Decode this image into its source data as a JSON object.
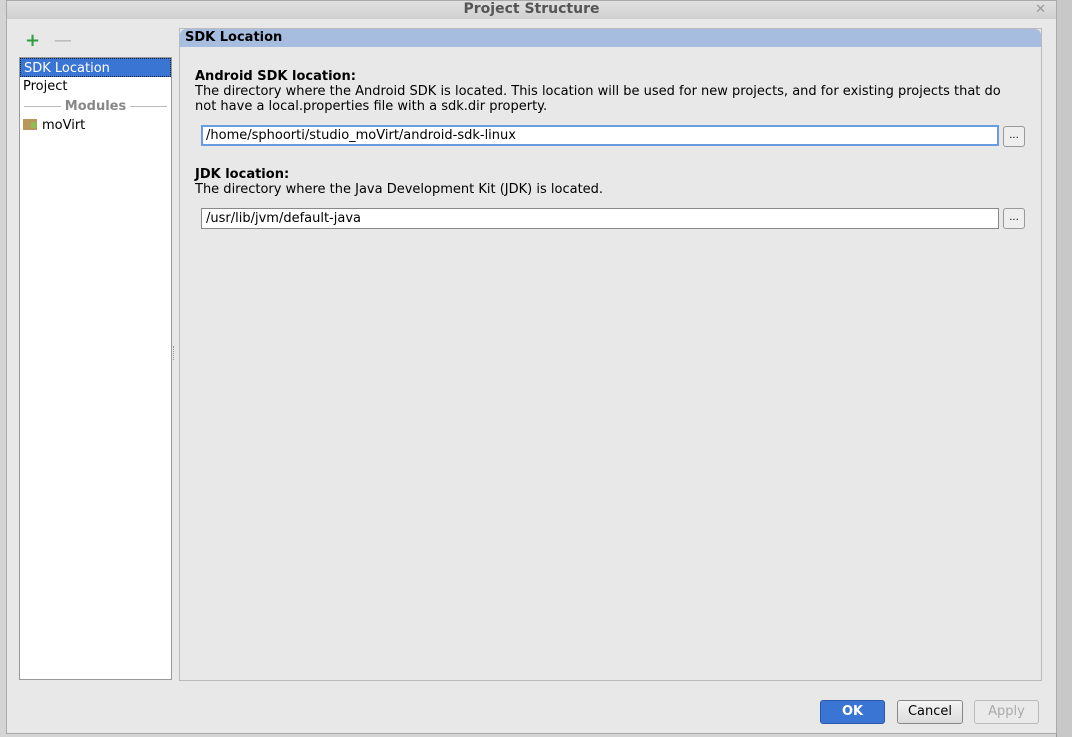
{
  "window": {
    "title": "Project Structure",
    "close_icon": "close-icon"
  },
  "toolbar": {
    "add": "+",
    "remove": "—"
  },
  "sidebar": {
    "items": [
      {
        "label": "SDK Location",
        "selected": true
      },
      {
        "label": "Project"
      }
    ],
    "modules_header": "Modules",
    "modules": [
      {
        "label": "moVirt",
        "icon": "module-folder-icon"
      }
    ]
  },
  "main": {
    "header": "SDK Location",
    "android_sdk": {
      "label": "Android SDK location:",
      "description": "The directory where the Android SDK is located. This location will be used for new projects, and for existing projects that do not have a local.properties file with a sdk.dir property.",
      "value": "/home/sphoorti/studio_moVirt/android-sdk-linux",
      "browse": "..."
    },
    "jdk": {
      "label": "JDK location:",
      "description": "The directory where the Java Development Kit (JDK) is located.",
      "value": "/usr/lib/jvm/default-java",
      "browse": "..."
    }
  },
  "buttons": {
    "ok": "OK",
    "cancel": "Cancel",
    "apply": "Apply"
  },
  "colors": {
    "accent": "#3a75d4",
    "header": "#a6bde0"
  }
}
